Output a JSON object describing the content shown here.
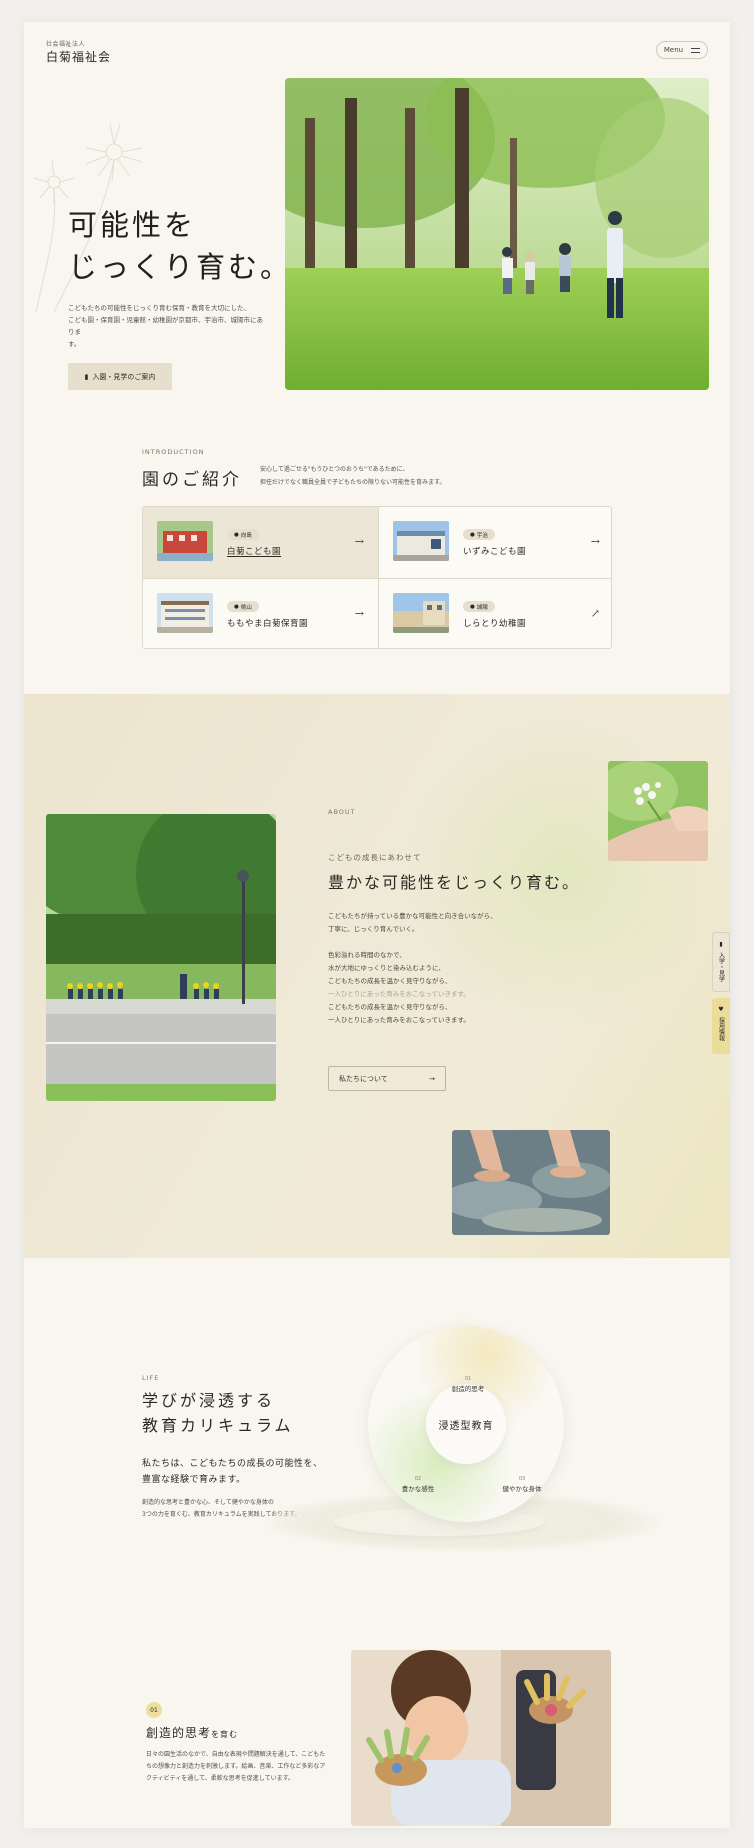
{
  "header": {
    "org_sub": "社会福祉法人",
    "org_name": "白菊福祉会",
    "menu_label": "Menu"
  },
  "hero": {
    "title_line1": "可能性を",
    "title_line2": "じっくり育む。",
    "desc_line1": "こどもたちの可能性をじっくり育む保育・教育を大切にした、",
    "desc_line2": "こども園・保育園・児童館・幼稚園が京都市、宇治市、城陽市にありま",
    "desc_line3": "す。",
    "button_label": "入園・見学のご案内"
  },
  "intro": {
    "label": "INTRODUCTION",
    "title": "園のご紹介",
    "desc_line1": "安心して過ごせる\"もうひとつのおうち\"であるために、",
    "desc_line2": "担任だけでなく職員全員で子どもたちの限りない可能性を育みます。",
    "items": [
      {
        "location": "向島",
        "name": "白菊こども園",
        "arrow": "→"
      },
      {
        "location": "宇治",
        "name": "いずみこども園",
        "arrow": "→"
      },
      {
        "location": "桃山",
        "name": "ももやま白菊保育園",
        "arrow": "→"
      },
      {
        "location": "城陽",
        "name": "しらとり幼稚園",
        "arrow": "↗"
      }
    ]
  },
  "about": {
    "label": "ABOUT",
    "sub": "こどもの成長にあわせて",
    "title": "豊かな可能性をじっくり育む。",
    "p1_line1": "こどもたちが持っている豊かな可能性と向き合いながら、",
    "p1_line2": "丁寧に、じっくり育んでいく。",
    "p2_line1": "色彩溢れる時間のなかで、",
    "p2_line2": "水が大地にゆっくりと染み込むように、",
    "p2_line3": "こどもたちの成長を温かく見守りながら、",
    "p2_line4": "一人ひとりにあった育みをおこなっていきます。",
    "p2_line5": "こどもたちの成長を温かく見守りながら、",
    "p2_line6": "一人ひとりにあった育みをおこなっていきます。",
    "button_label": "私たちについて",
    "button_arrow": "→"
  },
  "side_tabs": {
    "tab1": "入学・見学",
    "tab2": "採用情報"
  },
  "life": {
    "label": "LIFE",
    "title_line1": "学びが浸透する",
    "title_line2": "教育カリキュラム",
    "lead_line1": "私たちは、こどもたちの成長の可能性を、",
    "lead_line2": "豊富な経験で育みます。",
    "desc_line1": "創造的な思考と豊かな心、そして健やかな身体の",
    "desc_line2": "3つの力を育くむ、教育カリキュラムを実践しております。",
    "center": "浸透型教育",
    "items": [
      {
        "num": "01",
        "label": "創造的思考"
      },
      {
        "num": "02",
        "label": "豊かな感性"
      },
      {
        "num": "03",
        "label": "健やかな身体"
      }
    ]
  },
  "craft": {
    "num": "01",
    "title": "創造的思考",
    "title_suffix": "を育む",
    "desc_line1": "日々の園生活のなかで、自由な表現や問題解決を通して、こどもた",
    "desc_line2": "ちの想像力と創造力を刺激します。絵画、音楽、工作など多彩なア",
    "desc_line3": "クティビティを通して、柔軟な思考を促進しています。"
  }
}
